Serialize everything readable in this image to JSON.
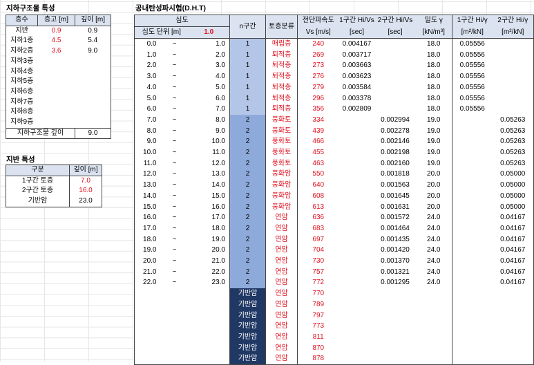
{
  "underground": {
    "title": "지하구조물 특성",
    "headers": [
      "층수",
      "층고 [m]",
      "깊이 [m]"
    ],
    "rows": [
      {
        "floor": "지반",
        "height": "0.9",
        "depth": "0.9"
      },
      {
        "floor": "지하1층",
        "height": "4.5",
        "depth": "5.4"
      },
      {
        "floor": "지하2층",
        "height": "3.6",
        "depth": "9.0"
      },
      {
        "floor": "지하3층",
        "height": "",
        "depth": ""
      },
      {
        "floor": "지하4층",
        "height": "",
        "depth": ""
      },
      {
        "floor": "지하5층",
        "height": "",
        "depth": ""
      },
      {
        "floor": "지하6층",
        "height": "",
        "depth": ""
      },
      {
        "floor": "지하7층",
        "height": "",
        "depth": ""
      },
      {
        "floor": "지하8층",
        "height": "",
        "depth": ""
      },
      {
        "floor": "지하9층",
        "height": "",
        "depth": ""
      }
    ],
    "total_label": "지하구조물 깊이",
    "total_value": "9.0"
  },
  "ground": {
    "title": "지반 특성",
    "headers": [
      "구분",
      "깊이 [m]"
    ],
    "rows": [
      {
        "label": "1구간 토층",
        "value": "7.0"
      },
      {
        "label": "2구간 토층",
        "value": "16.0"
      },
      {
        "label": "기반암",
        "value": "23.0"
      }
    ]
  },
  "dht": {
    "title": "공내탄성파시험(D.H.T)",
    "depth_header": "심도",
    "depth_unit_label": "심도 단위 [m]",
    "depth_unit_value": "1.0",
    "headers": {
      "n": "n구간",
      "soil": "토층분류",
      "vs_1": "전단파속도",
      "vs_2": "Vs [m/s]",
      "h1v_1": "1구간 Hi/Vs",
      "h1v_2": "[sec]",
      "h2v_1": "2구간 Hi/Vs",
      "h2v_2": "[sec]",
      "rho_1": "밀도 γ",
      "rho_2": "[kN/m³]",
      "h1g_1": "1구간 Hi/γ",
      "h1g_2": "[m²/kN]",
      "h2g_1": "2구간 Hi/γ",
      "h2g_2": "[m²/kN]"
    },
    "rows": [
      {
        "from": "0.0",
        "tilde": "~",
        "to": "1.0",
        "n": "1",
        "soil": "매립층",
        "vs": "240",
        "h1v": "0.004167",
        "h2v": "",
        "rho": "18.0",
        "h1g": "0.05556",
        "h2g": ""
      },
      {
        "from": "1.0",
        "tilde": "~",
        "to": "2.0",
        "n": "1",
        "soil": "퇴적층",
        "vs": "269",
        "h1v": "0.003717",
        "h2v": "",
        "rho": "18.0",
        "h1g": "0.05556",
        "h2g": ""
      },
      {
        "from": "2.0",
        "tilde": "~",
        "to": "3.0",
        "n": "1",
        "soil": "퇴적층",
        "vs": "273",
        "h1v": "0.003663",
        "h2v": "",
        "rho": "18.0",
        "h1g": "0.05556",
        "h2g": ""
      },
      {
        "from": "3.0",
        "tilde": "~",
        "to": "4.0",
        "n": "1",
        "soil": "퇴적층",
        "vs": "276",
        "h1v": "0.003623",
        "h2v": "",
        "rho": "18.0",
        "h1g": "0.05556",
        "h2g": ""
      },
      {
        "from": "4.0",
        "tilde": "~",
        "to": "5.0",
        "n": "1",
        "soil": "퇴적층",
        "vs": "279",
        "h1v": "0.003584",
        "h2v": "",
        "rho": "18.0",
        "h1g": "0.05556",
        "h2g": ""
      },
      {
        "from": "5.0",
        "tilde": "~",
        "to": "6.0",
        "n": "1",
        "soil": "퇴적층",
        "vs": "296",
        "h1v": "0.003378",
        "h2v": "",
        "rho": "18.0",
        "h1g": "0.05556",
        "h2g": ""
      },
      {
        "from": "6.0",
        "tilde": "~",
        "to": "7.0",
        "n": "1",
        "soil": "퇴적층",
        "vs": "356",
        "h1v": "0.002809",
        "h2v": "",
        "rho": "18.0",
        "h1g": "0.05556",
        "h2g": ""
      },
      {
        "from": "7.0",
        "tilde": "~",
        "to": "8.0",
        "n": "2",
        "soil": "풍화토",
        "vs": "334",
        "h1v": "",
        "h2v": "0.002994",
        "rho": "19.0",
        "h1g": "",
        "h2g": "0.05263"
      },
      {
        "from": "8.0",
        "tilde": "~",
        "to": "9.0",
        "n": "2",
        "soil": "풍화토",
        "vs": "439",
        "h1v": "",
        "h2v": "0.002278",
        "rho": "19.0",
        "h1g": "",
        "h2g": "0.05263"
      },
      {
        "from": "9.0",
        "tilde": "~",
        "to": "10.0",
        "n": "2",
        "soil": "풍화토",
        "vs": "466",
        "h1v": "",
        "h2v": "0.002146",
        "rho": "19.0",
        "h1g": "",
        "h2g": "0.05263"
      },
      {
        "from": "10.0",
        "tilde": "~",
        "to": "11.0",
        "n": "2",
        "soil": "풍화토",
        "vs": "455",
        "h1v": "",
        "h2v": "0.002198",
        "rho": "19.0",
        "h1g": "",
        "h2g": "0.05263"
      },
      {
        "from": "11.0",
        "tilde": "~",
        "to": "12.0",
        "n": "2",
        "soil": "풍화토",
        "vs": "463",
        "h1v": "",
        "h2v": "0.002160",
        "rho": "19.0",
        "h1g": "",
        "h2g": "0.05263"
      },
      {
        "from": "12.0",
        "tilde": "~",
        "to": "13.0",
        "n": "2",
        "soil": "풍화암",
        "vs": "550",
        "h1v": "",
        "h2v": "0.001818",
        "rho": "20.0",
        "h1g": "",
        "h2g": "0.05000"
      },
      {
        "from": "13.0",
        "tilde": "~",
        "to": "14.0",
        "n": "2",
        "soil": "풍화암",
        "vs": "640",
        "h1v": "",
        "h2v": "0.001563",
        "rho": "20.0",
        "h1g": "",
        "h2g": "0.05000"
      },
      {
        "from": "14.0",
        "tilde": "~",
        "to": "15.0",
        "n": "2",
        "soil": "풍화암",
        "vs": "608",
        "h1v": "",
        "h2v": "0.001645",
        "rho": "20.0",
        "h1g": "",
        "h2g": "0.05000"
      },
      {
        "from": "15.0",
        "tilde": "~",
        "to": "16.0",
        "n": "2",
        "soil": "풍화암",
        "vs": "613",
        "h1v": "",
        "h2v": "0.001631",
        "rho": "20.0",
        "h1g": "",
        "h2g": "0.05000"
      },
      {
        "from": "16.0",
        "tilde": "~",
        "to": "17.0",
        "n": "2",
        "soil": "연암",
        "vs": "636",
        "h1v": "",
        "h2v": "0.001572",
        "rho": "24.0",
        "h1g": "",
        "h2g": "0.04167"
      },
      {
        "from": "17.0",
        "tilde": "~",
        "to": "18.0",
        "n": "2",
        "soil": "연암",
        "vs": "683",
        "h1v": "",
        "h2v": "0.001464",
        "rho": "24.0",
        "h1g": "",
        "h2g": "0.04167"
      },
      {
        "from": "18.0",
        "tilde": "~",
        "to": "19.0",
        "n": "2",
        "soil": "연암",
        "vs": "697",
        "h1v": "",
        "h2v": "0.001435",
        "rho": "24.0",
        "h1g": "",
        "h2g": "0.04167"
      },
      {
        "from": "19.0",
        "tilde": "~",
        "to": "20.0",
        "n": "2",
        "soil": "연암",
        "vs": "704",
        "h1v": "",
        "h2v": "0.001420",
        "rho": "24.0",
        "h1g": "",
        "h2g": "0.04167"
      },
      {
        "from": "20.0",
        "tilde": "~",
        "to": "21.0",
        "n": "2",
        "soil": "연암",
        "vs": "730",
        "h1v": "",
        "h2v": "0.001370",
        "rho": "24.0",
        "h1g": "",
        "h2g": "0.04167"
      },
      {
        "from": "21.0",
        "tilde": "~",
        "to": "22.0",
        "n": "2",
        "soil": "연암",
        "vs": "757",
        "h1v": "",
        "h2v": "0.001321",
        "rho": "24.0",
        "h1g": "",
        "h2g": "0.04167"
      },
      {
        "from": "22.0",
        "tilde": "~",
        "to": "23.0",
        "n": "2",
        "soil": "연암",
        "vs": "772",
        "h1v": "",
        "h2v": "0.001295",
        "rho": "24.0",
        "h1g": "",
        "h2g": "0.04167"
      },
      {
        "from": "",
        "tilde": "",
        "to": "",
        "n": "기반암",
        "soil": "연암",
        "vs": "770",
        "h1v": "",
        "h2v": "",
        "rho": "",
        "h1g": "",
        "h2g": ""
      },
      {
        "from": "",
        "tilde": "",
        "to": "",
        "n": "기반암",
        "soil": "연암",
        "vs": "789",
        "h1v": "",
        "h2v": "",
        "rho": "",
        "h1g": "",
        "h2g": ""
      },
      {
        "from": "",
        "tilde": "",
        "to": "",
        "n": "기반암",
        "soil": "연암",
        "vs": "797",
        "h1v": "",
        "h2v": "",
        "rho": "",
        "h1g": "",
        "h2g": ""
      },
      {
        "from": "",
        "tilde": "",
        "to": "",
        "n": "기반암",
        "soil": "연암",
        "vs": "773",
        "h1v": "",
        "h2v": "",
        "rho": "",
        "h1g": "",
        "h2g": ""
      },
      {
        "from": "",
        "tilde": "",
        "to": "",
        "n": "기반암",
        "soil": "연암",
        "vs": "811",
        "h1v": "",
        "h2v": "",
        "rho": "",
        "h1g": "",
        "h2g": ""
      },
      {
        "from": "",
        "tilde": "",
        "to": "",
        "n": "기반암",
        "soil": "연암",
        "vs": "870",
        "h1v": "",
        "h2v": "",
        "rho": "",
        "h1g": "",
        "h2g": ""
      },
      {
        "from": "",
        "tilde": "",
        "to": "",
        "n": "기반암",
        "soil": "연암",
        "vs": "878",
        "h1v": "",
        "h2v": "",
        "rho": "",
        "h1g": "",
        "h2g": ""
      }
    ]
  }
}
